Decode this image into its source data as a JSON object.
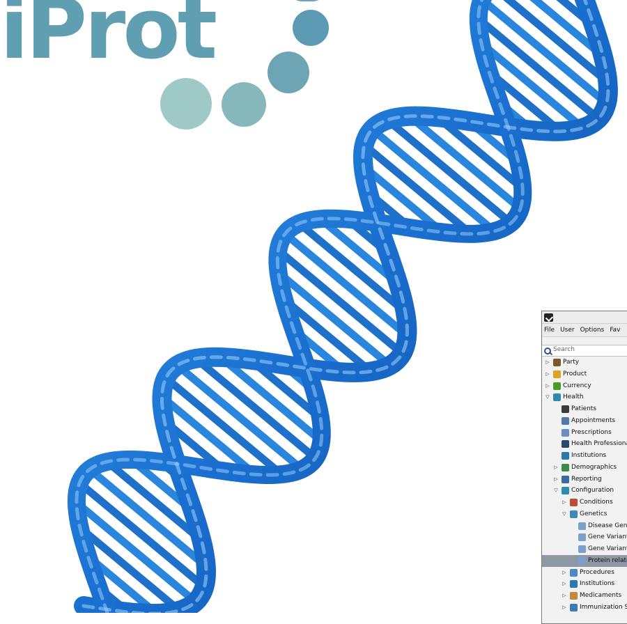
{
  "logo": {
    "text": "iProt"
  },
  "window": {
    "menu": [
      "File",
      "User",
      "Options",
      "Fav"
    ],
    "search": {
      "placeholder": "Search",
      "value": ""
    },
    "tree": [
      {
        "label": "Party",
        "level": 0,
        "expander": "collapsed",
        "icon": "party-icon",
        "color": "#7a5a2a"
      },
      {
        "label": "Product",
        "level": 0,
        "expander": "collapsed",
        "icon": "product-icon",
        "color": "#e0a020"
      },
      {
        "label": "Currency",
        "level": 0,
        "expander": "collapsed",
        "icon": "currency-icon",
        "color": "#4a9a2a"
      },
      {
        "label": "Health",
        "level": 0,
        "expander": "expanded",
        "icon": "health-icon",
        "color": "#2e8ab0"
      },
      {
        "label": "Patients",
        "level": 1,
        "expander": "none",
        "icon": "patients-icon",
        "color": "#3a3a3a"
      },
      {
        "label": "Appointments",
        "level": 1,
        "expander": "none",
        "icon": "appointments-icon",
        "color": "#5577aa"
      },
      {
        "label": "Prescriptions",
        "level": 1,
        "expander": "none",
        "icon": "prescriptions-icon",
        "color": "#6d8fc0"
      },
      {
        "label": "Health Professionals",
        "level": 1,
        "expander": "none",
        "icon": "health-professionals-icon",
        "color": "#2a4a6a"
      },
      {
        "label": "Institutions",
        "level": 1,
        "expander": "none",
        "icon": "institutions-icon",
        "color": "#2a7ab0"
      },
      {
        "label": "Demographics",
        "level": 1,
        "expander": "collapsed",
        "icon": "demographics-icon",
        "color": "#3a8a4a"
      },
      {
        "label": "Reporting",
        "level": 1,
        "expander": "collapsed",
        "icon": "reporting-icon",
        "color": "#3a6aa0"
      },
      {
        "label": "Configuration",
        "level": 1,
        "expander": "expanded",
        "icon": "configuration-icon",
        "color": "#2e8ab0"
      },
      {
        "label": "Conditions",
        "level": 2,
        "expander": "collapsed",
        "icon": "conditions-icon",
        "color": "#c04a3a"
      },
      {
        "label": "Genetics",
        "level": 2,
        "expander": "expanded",
        "icon": "genetics-icon",
        "color": "#3a8aba"
      },
      {
        "label": "Disease Genes",
        "level": 3,
        "expander": "none",
        "icon": "document-icon",
        "color": "#7aa0d0"
      },
      {
        "label": "Gene Variants",
        "level": 3,
        "expander": "none",
        "icon": "document-icon",
        "color": "#7aa0d0"
      },
      {
        "label": "Gene Variant Phenotypes",
        "level": 3,
        "expander": "none",
        "icon": "document-icon",
        "color": "#7aa0d0"
      },
      {
        "label": "Protein related disorders",
        "level": 3,
        "expander": "none",
        "icon": "document-icon",
        "color": "#7aa0d0",
        "selected": true
      },
      {
        "label": "Procedures",
        "level": 2,
        "expander": "collapsed",
        "icon": "procedures-icon",
        "color": "#4a8ac0"
      },
      {
        "label": "Institutions",
        "level": 2,
        "expander": "collapsed",
        "icon": "institutions-icon",
        "color": "#2a7ab0"
      },
      {
        "label": "Medicaments",
        "level": 2,
        "expander": "collapsed",
        "icon": "medicaments-icon",
        "color": "#c08a3a"
      },
      {
        "label": "Immunization Schedules",
        "level": 2,
        "expander": "collapsed",
        "icon": "immunization-icon",
        "color": "#3a7ab0"
      }
    ]
  }
}
